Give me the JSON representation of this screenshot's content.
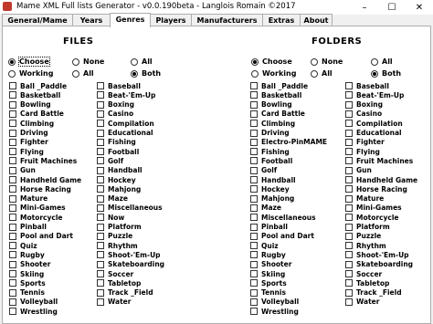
{
  "window": {
    "title": "Mame XML Full lists Generator - v0.0.190beta - Langlois Romain ©2017",
    "minimize": "–",
    "maximize": "☐",
    "close": "✕"
  },
  "tabs": [
    "General/Mame",
    "Years",
    "Genres",
    "Players",
    "Manufacturers",
    "Extras",
    "About"
  ],
  "active_tab": "Genres",
  "files": {
    "title": "FILES",
    "radios": [
      {
        "label": "Choose",
        "selected": true
      },
      {
        "label": "None",
        "selected": false
      },
      {
        "label": "All",
        "selected": false
      }
    ],
    "mode": [
      {
        "label": "Working",
        "selected": false
      },
      {
        "label": "All",
        "selected": false
      },
      {
        "label": "Both",
        "selected": true
      }
    ]
  },
  "folders": {
    "title": "FOLDERS",
    "radios": [
      {
        "label": "Choose",
        "selected": true
      },
      {
        "label": "None",
        "selected": false
      },
      {
        "label": "All",
        "selected": false
      }
    ],
    "mode": [
      {
        "label": "Working",
        "selected": false
      },
      {
        "label": "All",
        "selected": false
      },
      {
        "label": "Both",
        "selected": true
      }
    ]
  },
  "files_col1": [
    "Ball _Paddle",
    "Basketball",
    "Bowling",
    "Card Battle",
    "Climbing",
    "Driving",
    "Fighter",
    "Flying",
    "Fruit Machines",
    "Gun",
    "Handheld Game",
    "Horse Racing",
    "Mature",
    "Mini-Games",
    "Motorcycle",
    "Pinball",
    "Pool and Dart",
    "Quiz",
    "Rugby",
    "Shooter",
    "Skiing",
    "Sports",
    "Tennis",
    "Volleyball",
    "Wrestling"
  ],
  "files_col2": [
    "Baseball",
    "Beat-'Em-Up",
    "Boxing",
    "Casino",
    "Compilation",
    "Educational",
    "Fishing",
    "Football",
    "Golf",
    "Handball",
    "Hockey",
    "Mahjong",
    "Maze",
    "Miscellaneous",
    "Now",
    "Platform",
    "Puzzle",
    "Rhythm",
    "Shoot-'Em-Up",
    "Skateboarding",
    "Soccer",
    "Tabletop",
    "Track _Field",
    "Water"
  ],
  "folders_col1": [
    "Ball _Paddle",
    "Basketball",
    "Bowling",
    "Card Battle",
    "Climbing",
    "Driving",
    "Electro-PinMAME",
    "Fishing",
    "Football",
    "Golf",
    "Handball",
    "Hockey",
    "Mahjong",
    "Maze",
    "Miscellaneous",
    "Pinball",
    "Pool and Dart",
    "Quiz",
    "Rugby",
    "Shooter",
    "Skiing",
    "Sports",
    "Tennis",
    "Volleyball",
    "Wrestling"
  ],
  "folders_col2": [
    "Baseball",
    "Beat-'Em-Up",
    "Boxing",
    "Casino",
    "Compilation",
    "Educational",
    "Fighter",
    "Flying",
    "Fruit Machines",
    "Gun",
    "Handheld Game",
    "Horse Racing",
    "Mature",
    "Mini-Games",
    "Motorcycle",
    "Platform",
    "Puzzle",
    "Rhythm",
    "Shoot-'Em-Up",
    "Skateboarding",
    "Soccer",
    "Tabletop",
    "Track _Field",
    "Water"
  ]
}
